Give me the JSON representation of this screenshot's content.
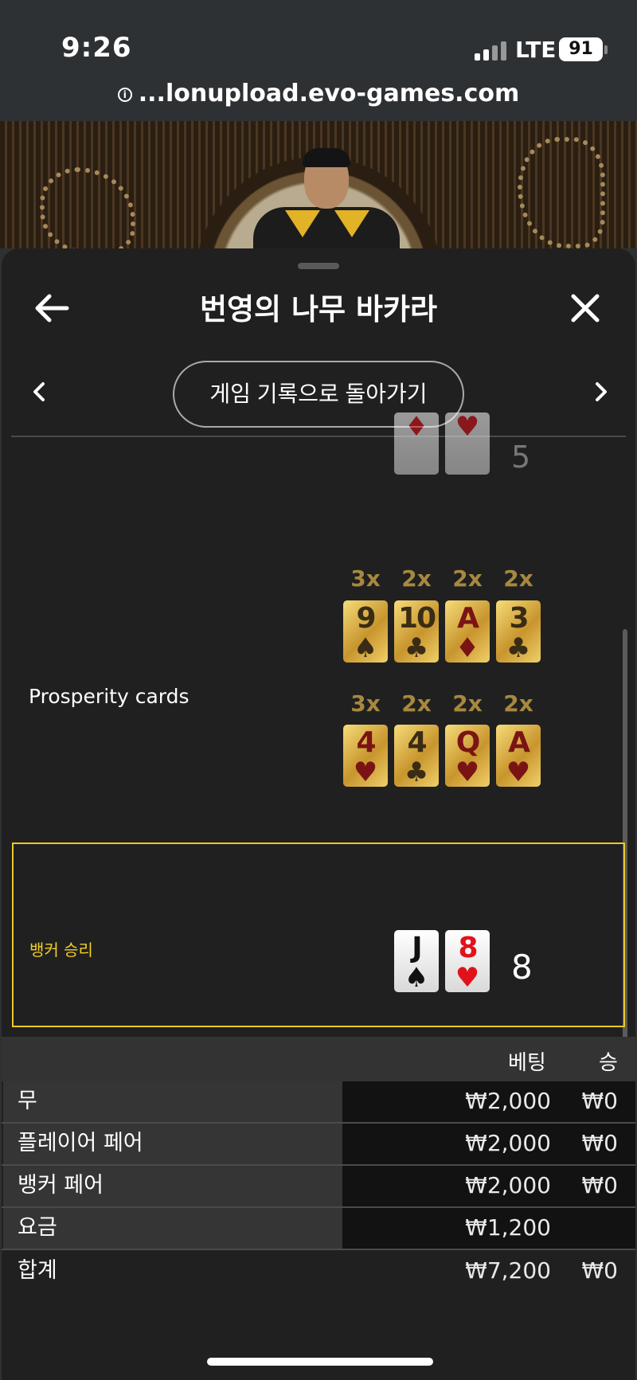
{
  "status": {
    "time": "9:26",
    "network": "LTE",
    "battery": "91"
  },
  "browser": {
    "url": "...lonupload.evo-games.com",
    "info_icon": "info-icon"
  },
  "sheet": {
    "title": "번영의 나무 바카라",
    "history_button": "게임 기록으로 돌아가기"
  },
  "prev_row": {
    "cards": [
      {
        "suit": "♦",
        "color": "red"
      },
      {
        "suit": "♥",
        "color": "red"
      }
    ],
    "score": "5"
  },
  "prosperity": {
    "label": "Prosperity cards",
    "row1": [
      {
        "mult": "3x",
        "rank": "9",
        "suit": "♠",
        "ink": "black"
      },
      {
        "mult": "2x",
        "rank": "10",
        "suit": "♣",
        "ink": "black"
      },
      {
        "mult": "2x",
        "rank": "A",
        "suit": "♦",
        "ink": "red"
      },
      {
        "mult": "2x",
        "rank": "3",
        "suit": "♣",
        "ink": "black"
      }
    ],
    "row2": [
      {
        "mult": "3x",
        "rank": "4",
        "suit": "♥",
        "ink": "red"
      },
      {
        "mult": "2x",
        "rank": "4",
        "suit": "♣",
        "ink": "black"
      },
      {
        "mult": "2x",
        "rank": "Q",
        "suit": "♥",
        "ink": "red"
      },
      {
        "mult": "2x",
        "rank": "A",
        "suit": "♥",
        "ink": "red"
      }
    ]
  },
  "result": {
    "label": "뱅커 승리",
    "cards": [
      {
        "rank": "J",
        "suit": "♠",
        "ink": "black"
      },
      {
        "rank": "8",
        "suit": "♥",
        "ink": "red"
      }
    ],
    "score": "8"
  },
  "bets": {
    "header_bet": "베팅",
    "header_win": "승",
    "rows": [
      {
        "name": "무",
        "bet": "₩2,000",
        "win": "₩0"
      },
      {
        "name": "플레이어 페어",
        "bet": "₩2,000",
        "win": "₩0"
      },
      {
        "name": "뱅커 페어",
        "bet": "₩2,000",
        "win": "₩0"
      },
      {
        "name": "요금",
        "bet": "₩1,200",
        "win": ""
      }
    ],
    "total": {
      "name": "합계",
      "bet": "₩7,200",
      "win": "₩0"
    }
  },
  "colors": {
    "accent_yellow": "#e9c928",
    "card_red": "#e0131b",
    "gold": "#c8952d"
  }
}
